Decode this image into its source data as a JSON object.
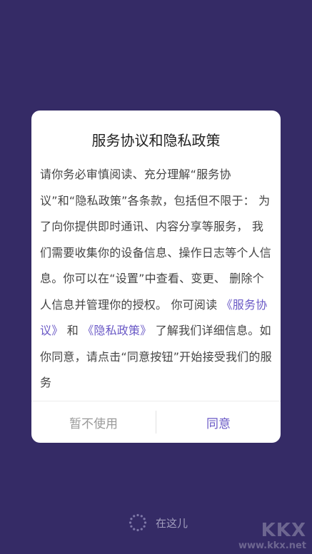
{
  "dialog": {
    "title": "服务协议和隐私政策",
    "body": {
      "text_1": "请你务必审慎阅读、充分理解“服务协议”和“隐私政策”各条款，包括但不限于： 为了向你提供即时通讯、内容分享等服务， 我们需要收集你的设备信息、操作日志等个人信息。你可以在“设置”中查看、变更、 删除个人信息并管理你的授权。 你可阅读",
      "link_service": "《服务协议》",
      "and": "和",
      "link_privacy": "《隐私政策》",
      "text_2": "了解我们详细信息。如你同意，请点击“同意按钮”开始接受我们的服务"
    },
    "decline_label": "暂不使用",
    "agree_label": "同意"
  },
  "footer": {
    "icon": "spinner-icon",
    "text": "在这儿"
  },
  "watermark": {
    "logo_text": "KKX",
    "url": "www.kkx.net"
  },
  "colors": {
    "background": "#352b66",
    "accent": "#6a59c6"
  }
}
